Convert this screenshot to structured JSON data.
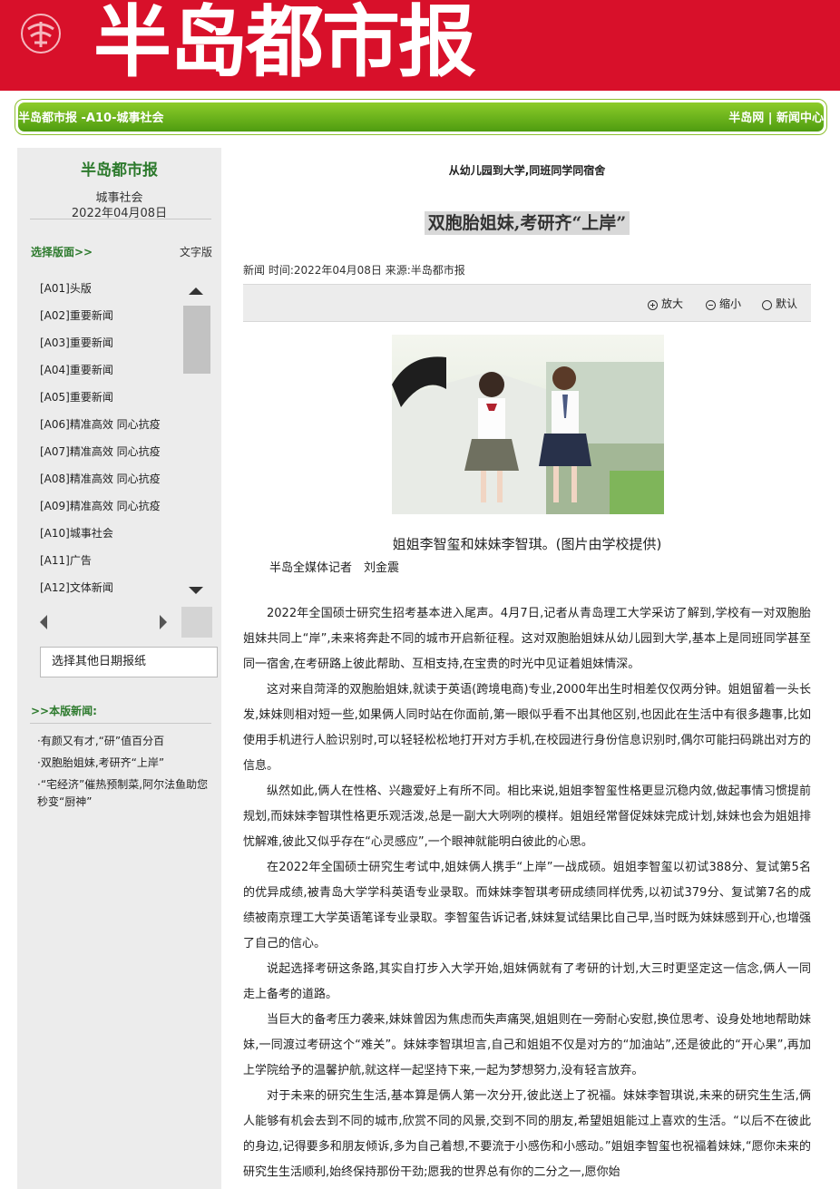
{
  "masthead": {
    "title": "半岛都市报"
  },
  "topbar": {
    "left": "半岛都市报 -A10-城事社会",
    "right": "半岛网 | 新闻中心"
  },
  "sidebar": {
    "paper_name": "半岛都市报",
    "section": "城事社会",
    "date": "2022年04月08日",
    "select_page": "选择版面>>",
    "text_version": "文字版",
    "pages": [
      "[A01]头版",
      "[A02]重要新闻",
      "[A03]重要新闻",
      "[A04]重要新闻",
      "[A05]重要新闻",
      "[A06]精准高效 同心抗疫",
      "[A07]精准高效 同心抗疫",
      "[A08]精准高效 同心抗疫",
      "[A09]精准高效 同心抗疫",
      "[A10]城事社会",
      "[A11]广告",
      "[A12]文体新闻"
    ],
    "other_date": "选择其他日期报纸",
    "page_news": ">>本版新闻:",
    "news": [
      "·有颜又有才,“研”值百分百",
      "·双胞胎姐妹,考研齐“上岸”",
      "·“宅经济”催热预制菜,阿尔法鱼助您秒变“厨神”"
    ]
  },
  "article": {
    "subtitle": "从幼儿园到大学,同班同学同宿舍",
    "title": "双胞胎姐妹,考研齐“上岸”",
    "meta": "新闻    时间:2022年04月08日    来源:半岛都市报",
    "zoom_in": "放大",
    "zoom_out": "缩小",
    "default": "默认",
    "caption": "姐姐李智玺和妹妹李智琪。(图片由学校提供)",
    "reporter": "半岛全媒体记者　刘金震",
    "paragraphs": [
      "2022年全国硕士研究生招考基本进入尾声。4月7日,记者从青岛理工大学采访了解到,学校有一对双胞胎姐妹共同上“岸”,未来将奔赴不同的城市开启新征程。这对双胞胎姐妹从幼儿园到大学,基本上是同班同学甚至同一宿舍,在考研路上彼此帮助、互相支持,在宝贵的时光中见证着姐妹情深。",
      "这对来自菏泽的双胞胎姐妹,就读于英语(跨境电商)专业,2000年出生时相差仅仅两分钟。姐姐留着一头长发,妹妹则相对短一些,如果俩人同时站在你面前,第一眼似乎看不出其他区别,也因此在生活中有很多趣事,比如使用手机进行人脸识别时,可以轻轻松松地打开对方手机,在校园进行身份信息识别时,偶尔可能扫码跳出对方的信息。",
      "纵然如此,俩人在性格、兴趣爱好上有所不同。相比来说,姐姐李智玺性格更显沉稳内敛,做起事情习惯提前规划,而妹妹李智琪性格更乐观活泼,总是一副大大咧咧的模样。姐姐经常督促妹妹完成计划,妹妹也会为姐姐排忧解难,彼此又似乎存在“心灵感应”,一个眼神就能明白彼此的心思。",
      "在2022年全国硕士研究生考试中,姐妹俩人携手“上岸”一战成硕。姐姐李智玺以初试388分、复试第5名的优异成绩,被青岛大学学科英语专业录取。而妹妹李智琪考研成绩同样优秀,以初试379分、复试第7名的成绩被南京理工大学英语笔译专业录取。李智玺告诉记者,妹妹复试结果比自己早,当时既为妹妹感到开心,也增强了自己的信心。",
      "说起选择考研这条路,其实自打步入大学开始,姐妹俩就有了考研的计划,大三时更坚定这一信念,俩人一同走上备考的道路。",
      "当巨大的备考压力袭来,妹妹曾因为焦虑而失声痛哭,姐姐则在一旁耐心安慰,换位思考、设身处地地帮助妹妹,一同渡过考研这个“难关”。妹妹李智琪坦言,自己和姐姐不仅是对方的“加油站”,还是彼此的“开心果”,再加上学院给予的温馨护航,就这样一起坚持下来,一起为梦想努力,没有轻言放弃。",
      "对于未来的研究生生活,基本算是俩人第一次分开,彼此送上了祝福。妹妹李智琪说,未来的研究生生活,俩人能够有机会去到不同的城市,欣赏不同的风景,交到不同的朋友,希望姐姐能过上喜欢的生活。“以后不在彼此的身边,记得要多和朋友倾诉,多为自己着想,不要流于小感伤和小感动。”姐姐李智玺也祝福着妹妹,“愿你未来的研究生生活顺利,始终保持那份干劲;愿我的世界总有你的二分之一,愿你始"
    ]
  }
}
